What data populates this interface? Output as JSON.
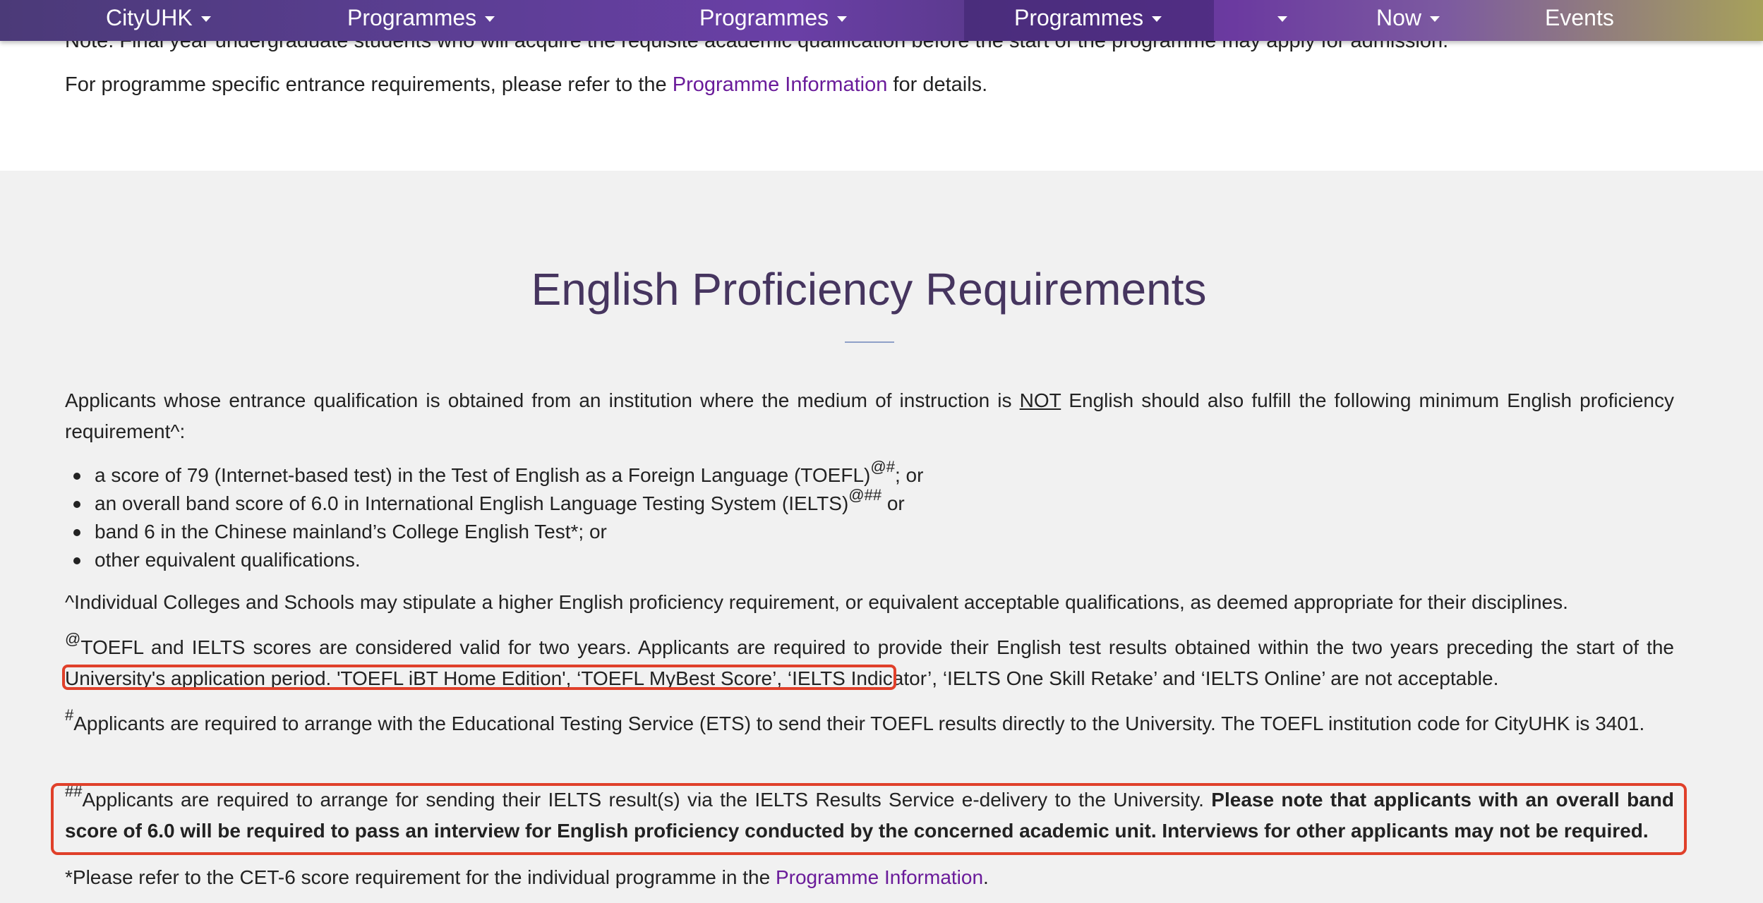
{
  "nav": {
    "items": [
      {
        "label": "CityUHK"
      },
      {
        "label": "Programmes"
      },
      {
        "label": "Programmes"
      },
      {
        "label": "Programmes"
      },
      {
        "label": ""
      },
      {
        "label": "Now"
      },
      {
        "label": "Events"
      }
    ]
  },
  "top": {
    "cut_text": "Note: Final year undergraduate students who will acquire the requisite academic qualification before the start of the programme may apply for admission.",
    "ref_prefix": "For programme specific entrance requirements, please refer to the ",
    "ref_link": "Programme Information",
    "ref_suffix": " for details."
  },
  "section": {
    "title": "English Proficiency Requirements",
    "intro_a": "Applicants whose entrance qualification is obtained from an institution where the medium of instruction is ",
    "intro_not": "NOT",
    "intro_b": " English should also fulfill the following minimum English proficiency requirement^:",
    "list": [
      {
        "text": "a score of 79 (Internet-based test) in the Test of English as a Foreign Language (TOEFL)",
        "sup": "@#",
        "tail": "; or"
      },
      {
        "text": "an overall band score of 6.0 in International English Language Testing System (IELTS)",
        "sup": "@##",
        "tail": " or"
      },
      {
        "text": "band 6 in the Chinese mainland’s College English Test*; or"
      },
      {
        "text": "other equivalent qualifications."
      }
    ],
    "note_caret": "^Individual Colleges and Schools may stipulate a higher English proficiency requirement, or equivalent acceptable qualifications, as deemed appropriate for their disciplines.",
    "note_at_sup": "@",
    "note_at": "TOEFL and IELTS scores are considered valid for two years. Applicants are required to provide their English test results obtained within the two years preceding the start of the University's application period. 'TOEFL iBT Home Edition', ‘TOEFL MyBest Score’, ‘IELTS Indicator’, ‘IELTS One Skill Retake’ and ‘IELTS Online’ are not acceptable.",
    "note_hash_sup": "#",
    "note_hash": "Applicants are required to arrange with the Educational Testing Service (ETS) to send their TOEFL results directly to the University. The TOEFL institution code for CityUHK is 3401.",
    "note_dhash_sup": "##",
    "note_dhash": "Applicants are required to arrange for sending their IELTS result(s) via the IELTS Results Service e-delivery to the University. ",
    "note_dhash_bold": "Please note that applicants with an overall band score of 6.0 will be required to pass an interview for English proficiency conducted by the concerned academic unit. Interviews for other applicants may not be required.",
    "note_star_prefix": "*Please refer to the CET-6 score requirement for the individual programme in the ",
    "note_star_link": "Programme Information",
    "note_star_suffix": "."
  },
  "colors": {
    "accent": "#6a1b9a",
    "title": "#46355f",
    "highlight": "#e0402a"
  }
}
